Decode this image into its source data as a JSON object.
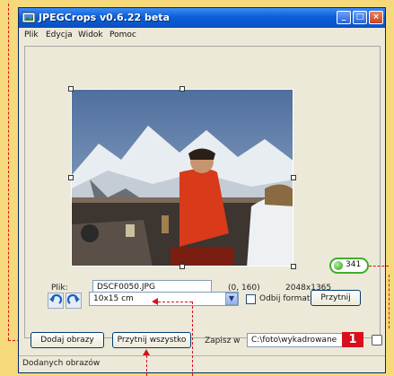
{
  "window": {
    "title": "JPEGCrops v0.6.22 beta"
  },
  "menu": [
    "Plik",
    "Edycja",
    "Widok",
    "Pomoc"
  ],
  "file": {
    "label": "Plik:",
    "name": "DSCF0050.JPG",
    "offset": "(0, 160)",
    "resolution": "2048x1365",
    "dpi": "341"
  },
  "format": {
    "selected": "10x15 cm",
    "mirror_label": "Odbij format",
    "apply_button": "Przytnij"
  },
  "actions": {
    "add_images": "Dodaj obrazy",
    "crop_all": "Przytnij wszystko",
    "save_label": "Zapisz w",
    "save_path": "C:\\foto\\wykadrowane"
  },
  "callout": {
    "number": "1"
  },
  "status": {
    "text": "Dodanych obrazów"
  },
  "icons": {
    "app": "app-icon",
    "rotate_left": "rotate-left-icon",
    "rotate_right": "rotate-right-icon",
    "dropdown": "chevron-down-icon",
    "status": "green-dot-icon"
  },
  "colors": {
    "accent_red": "#d8101e",
    "status_green": "#3fae2a",
    "title_blue": "#0a5fd8",
    "page_bg": "#f5d97a"
  }
}
